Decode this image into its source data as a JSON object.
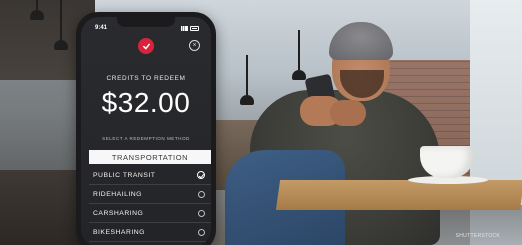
{
  "status_bar": {
    "time": "9:41"
  },
  "header": {
    "logo_icon": "brand-heart-check-icon",
    "close_icon": "close-icon",
    "close_glyph": "×"
  },
  "credits": {
    "label": "CREDITS TO REDEEM",
    "amount": "$32.00"
  },
  "method_prompt": "SELECT A REDEMPTION METHOD",
  "category": "TRANSPORTATION",
  "options": [
    {
      "label": "PUBLIC TRANSIT",
      "selected": true
    },
    {
      "label": "RIDEHAILING",
      "selected": false
    },
    {
      "label": "CARSHARING",
      "selected": false
    },
    {
      "label": "BIKESHARING",
      "selected": false
    }
  ],
  "colors": {
    "brand": "#d6243d",
    "screen_bg": "#262729",
    "category_bg": "#f7f7f7"
  },
  "watermark": "SHUTTERSTOCK"
}
